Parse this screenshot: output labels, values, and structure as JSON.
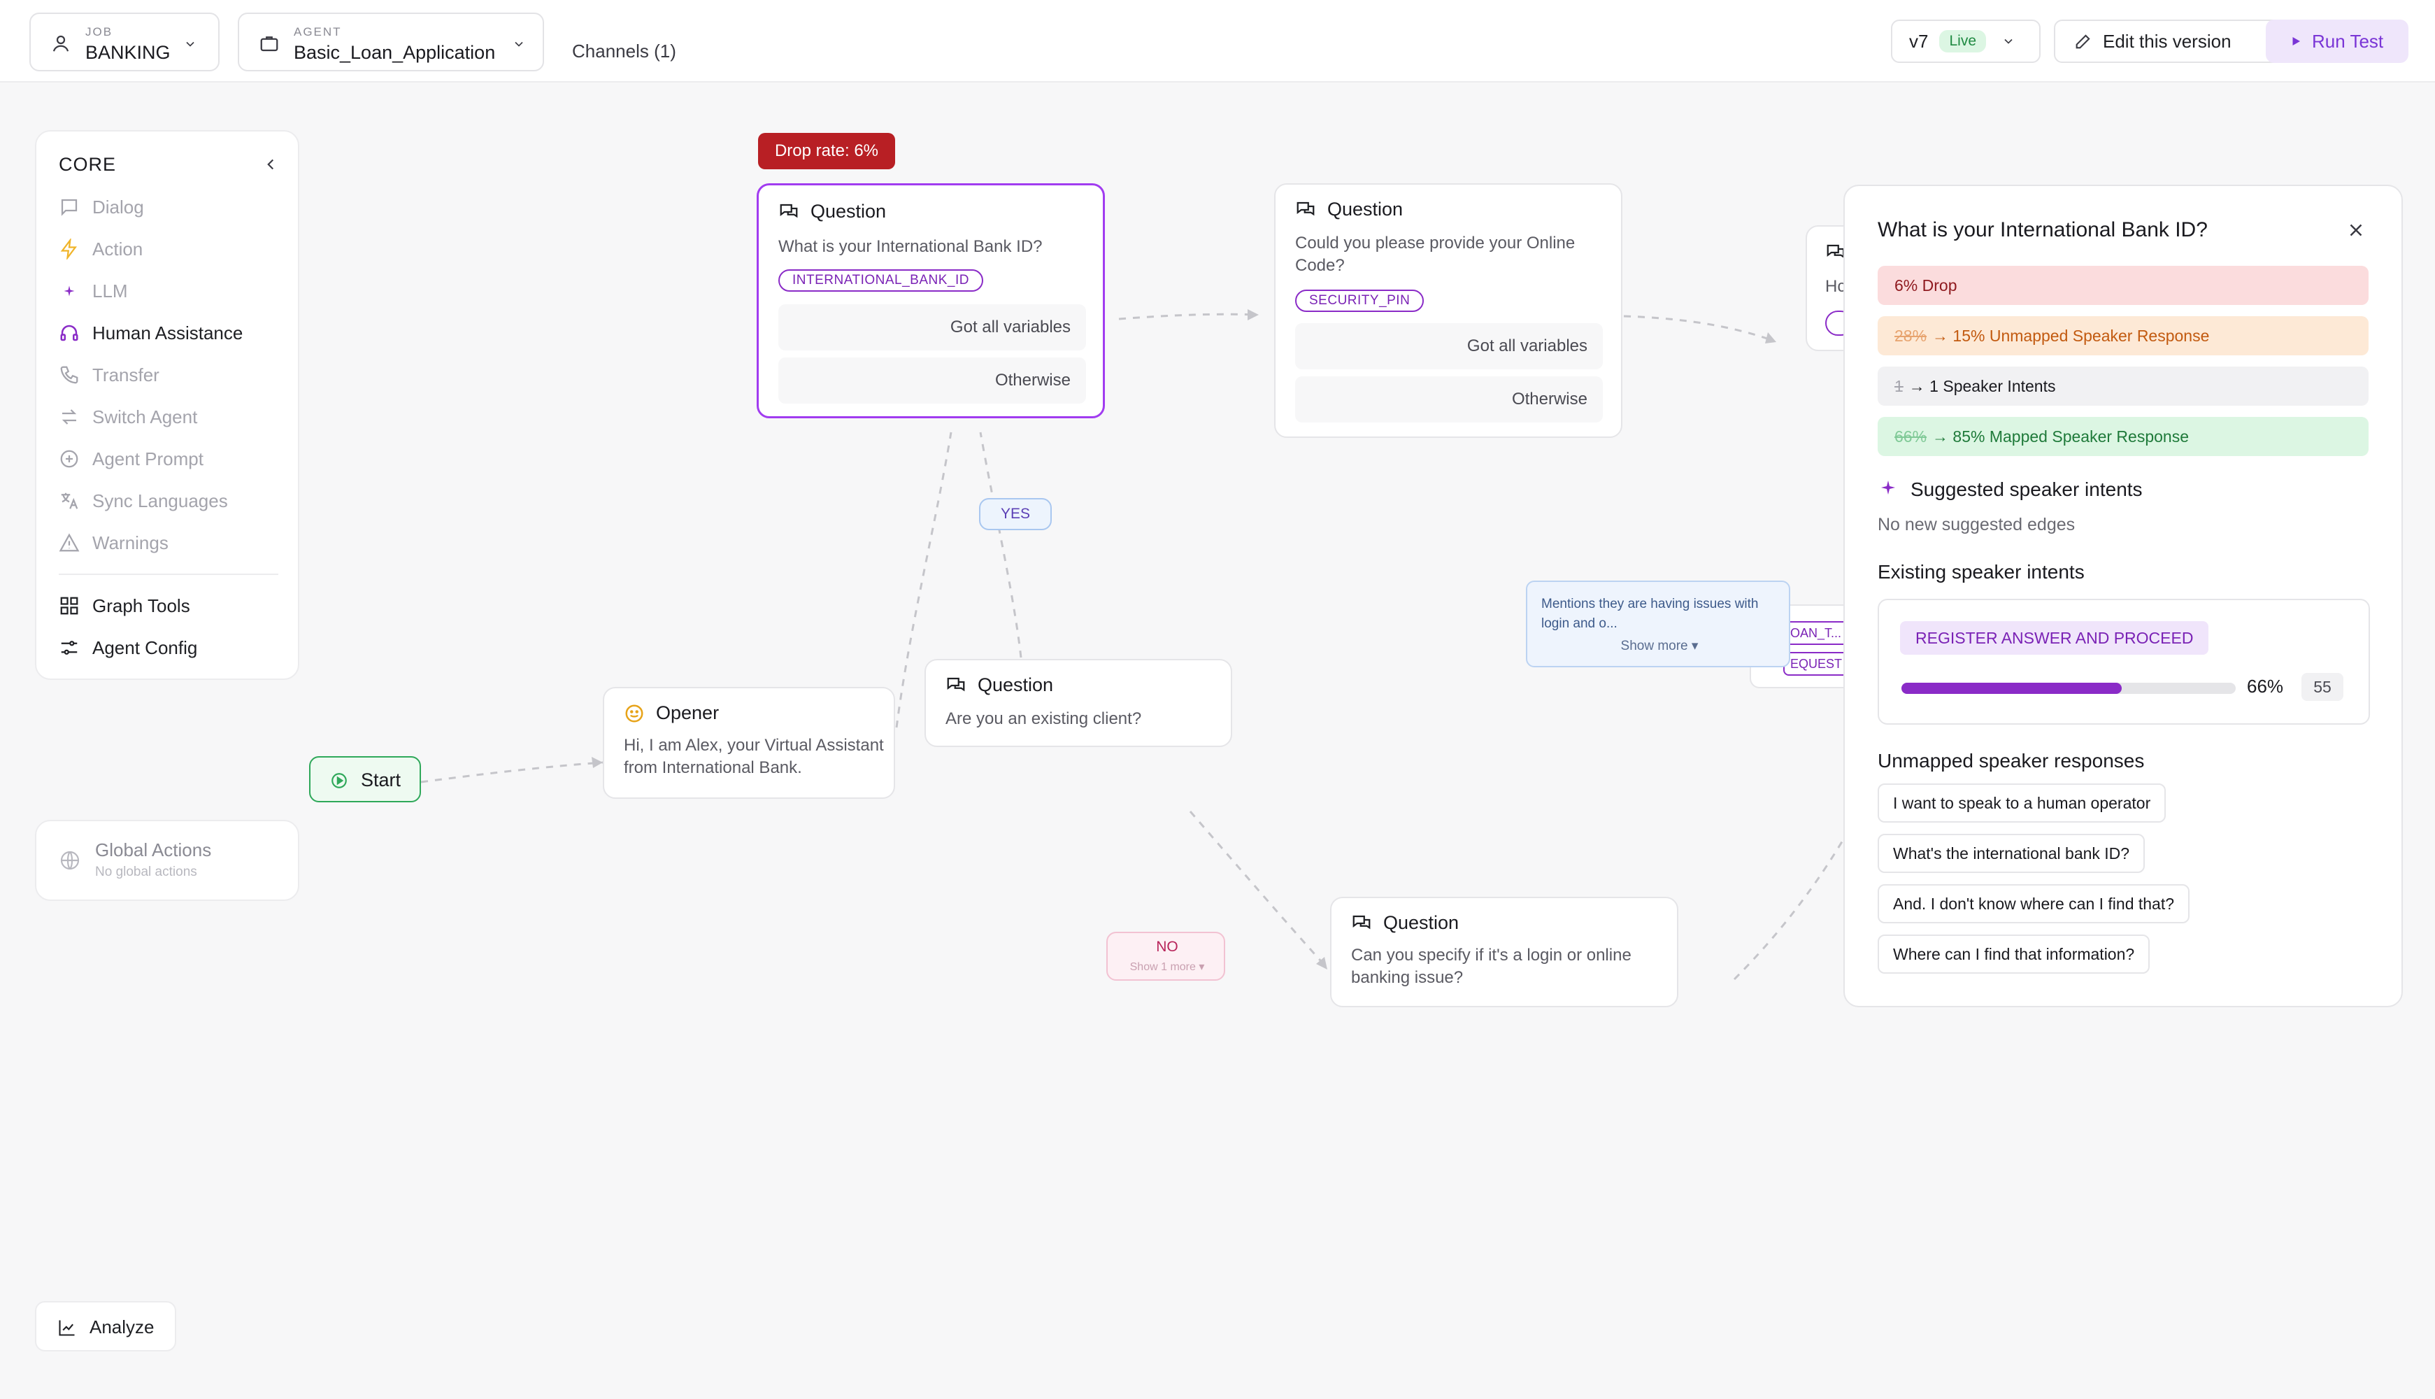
{
  "header": {
    "job_label": "JOB",
    "job_value": "BANKING",
    "agent_label": "AGENT",
    "agent_value": "Basic_Loan_Application",
    "channels": "Channels (1)",
    "version": "v7",
    "live": "Live",
    "edit": "Edit this version",
    "run": "Run Test"
  },
  "sidebar": {
    "title": "CORE",
    "items": [
      "Dialog",
      "Action",
      "LLM",
      "Human Assistance",
      "Transfer",
      "Switch Agent",
      "Agent Prompt",
      "Sync Languages",
      "Warnings"
    ],
    "tools": [
      "Graph Tools",
      "Agent Config"
    ]
  },
  "global_actions": {
    "title": "Global Actions",
    "subtitle": "No global actions"
  },
  "analyze": "Analyze",
  "canvas": {
    "start": "Start",
    "drop_rate": "Drop rate: 6%",
    "q1": {
      "title": "Question",
      "text": "What is your International Bank ID?",
      "tag": "INTERNATIONAL_BANK_ID",
      "out1": "Got all variables",
      "out2": "Otherwise"
    },
    "q2": {
      "title": "Question",
      "text": "Could you please provide your Online Code?",
      "tag": "SECURITY_PIN",
      "out1": "Got all variables",
      "out2": "Otherwise"
    },
    "q3_partial": {
      "text": "Hc"
    },
    "opener": {
      "title": "Opener",
      "text": "Hi, I am Alex, your Virtual Assistant from International Bank."
    },
    "q_existing": {
      "title": "Question",
      "text": "Are you an existing client?"
    },
    "q_login": {
      "title": "Question",
      "text": "Can you specify if it's a login or online banking issue?"
    },
    "yes": "YES",
    "no": "NO",
    "no_more": "Show 1 more ▾",
    "mentions": {
      "text": "Mentions they are having issues with login and o...",
      "more": "Show more ▾"
    },
    "partial_tags": [
      "OAN_T...",
      "EQUEST"
    ]
  },
  "right_panel": {
    "title": "What is your International Bank ID?",
    "drop": "6% Drop",
    "unmapped_old": "28%",
    "unmapped_new": "→ 15% Unmapped Speaker Response",
    "intents_old": "1",
    "intents_new": "→ 1 Speaker Intents",
    "mapped_old": "66%",
    "mapped_new": "→ 85% Mapped Speaker Response",
    "suggested_title": "Suggested speaker intents",
    "suggested_sub": "No new suggested edges",
    "existing_title": "Existing speaker intents",
    "intent_name": "REGISTER ANSWER AND PROCEED",
    "intent_pct": "66%",
    "intent_pct_value": 0.66,
    "intent_count": "55",
    "unmapped_title": "Unmapped speaker responses",
    "responses": [
      "I want to speak to a human operator",
      "What's the international bank ID?",
      "And. I don't know where can I find that?",
      "Where can I find that information?"
    ]
  },
  "colors": {
    "accent": "#8a2bc7",
    "drop": "#b81f24",
    "green": "#1f8a42"
  }
}
